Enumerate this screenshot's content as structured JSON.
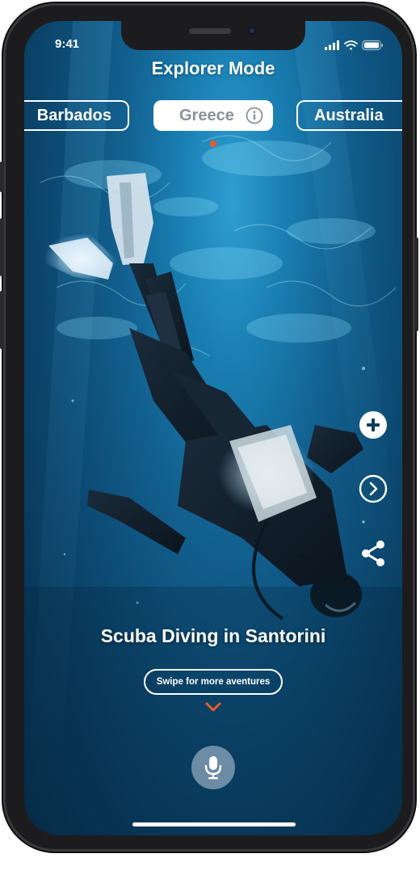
{
  "status_bar": {
    "time": "9:41",
    "icons": [
      "cellular-signal-icon",
      "wifi-icon",
      "battery-icon"
    ]
  },
  "header": {
    "title": "Explorer Mode"
  },
  "destinations": {
    "items": [
      {
        "label": "Barbados",
        "active": false
      },
      {
        "label": "Greece",
        "active": true
      },
      {
        "label": "Australia",
        "active": false
      }
    ],
    "selected": "Greece",
    "info_icon": "info-icon"
  },
  "side_actions": [
    {
      "name": "add-button",
      "icon": "plus-icon"
    },
    {
      "name": "next-button",
      "icon": "chevron-right-icon"
    },
    {
      "name": "share-button",
      "icon": "share-icon"
    }
  ],
  "content": {
    "caption": "Scuba Diving in Santorini",
    "swipe_label": "Swipe for more aventures",
    "swipe_icon": "chevron-down-icon"
  },
  "mic": {
    "icon": "microphone-icon"
  },
  "colors": {
    "accent": "#ee5a24",
    "water_light": "#2f9ed0",
    "water_dark": "#072f4c",
    "chip_active_bg": "#ffffff",
    "chip_active_text": "#8a929a"
  }
}
